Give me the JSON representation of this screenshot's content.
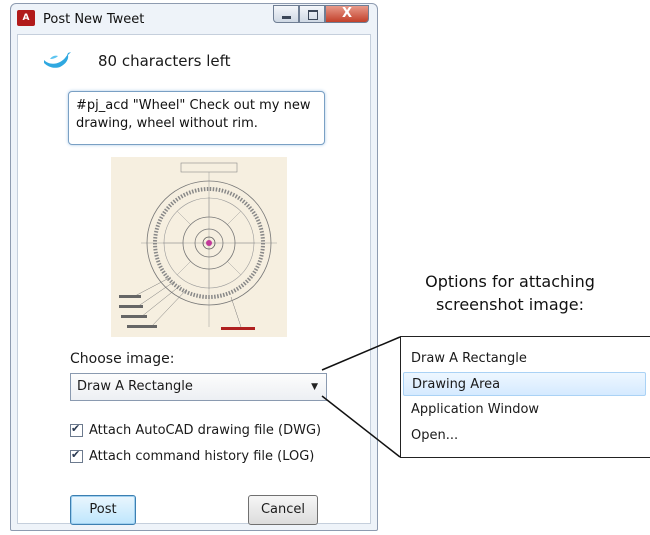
{
  "window": {
    "app_icon": "A",
    "title": "Post New Tweet",
    "min_icon": "minimize-icon",
    "max_icon": "maximize-icon",
    "close_label": "X"
  },
  "status": {
    "chars_left": "80  characters left",
    "bird_icon": "twitter-bird-icon"
  },
  "tweet": {
    "text": "#pj_acd \"Wheel\" Check out my new drawing, wheel without rim."
  },
  "choose": {
    "label": "Choose image:",
    "selected": "Draw A Rectangle",
    "arrow": "▼"
  },
  "checkboxes": [
    {
      "label": "Attach AutoCAD drawing file (DWG)",
      "checked": true
    },
    {
      "label": "Attach command history file (LOG)",
      "checked": true
    }
  ],
  "buttons": {
    "post": "Post",
    "cancel": "Cancel"
  },
  "annotation": {
    "line1": "Options for attaching",
    "line2": "screenshot image:"
  },
  "dropdown_options": [
    "Draw A Rectangle",
    "Drawing Area",
    "Application Window",
    "Open..."
  ],
  "colors": {
    "accent": "#3c7fb1",
    "highlight": "#d5eaff",
    "bird": "#2fa8e0"
  }
}
